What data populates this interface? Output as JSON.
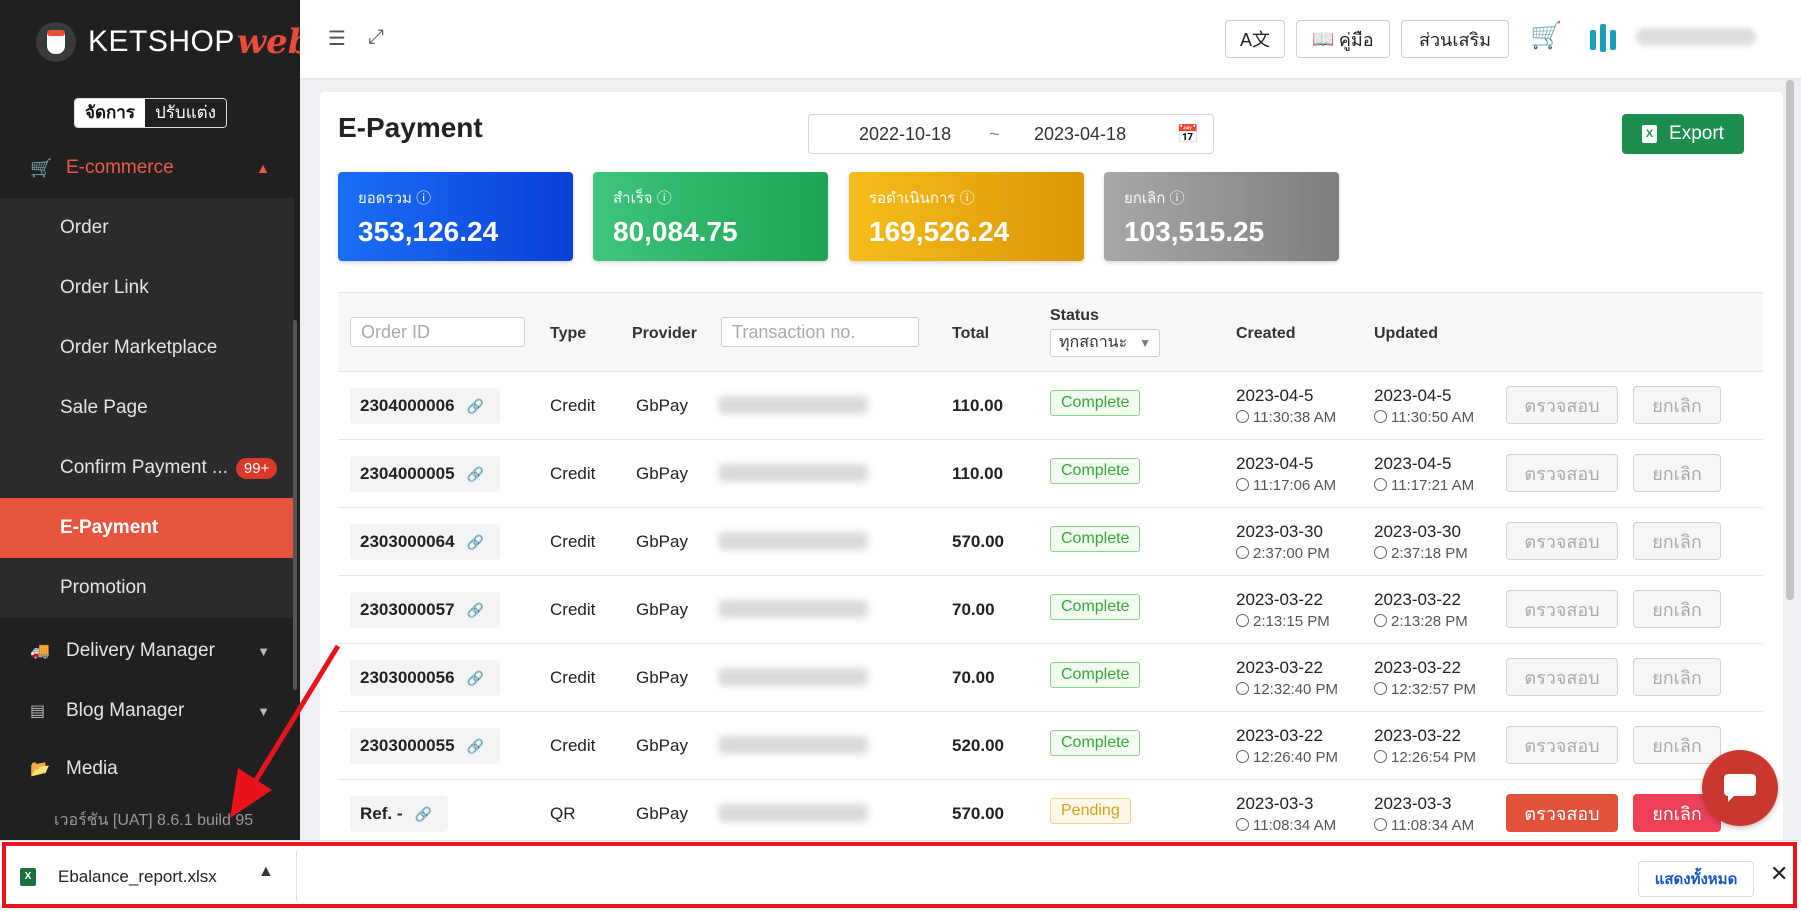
{
  "app": {
    "logo_text": "KETSHOP",
    "logo_accent": "web",
    "accent_color": "#e8553f"
  },
  "mode_switch": {
    "active": "จัดการ",
    "inactive": "ปรับแต่ง"
  },
  "sidebar": {
    "section": "E-commerce",
    "sub_items": [
      {
        "label": "Order"
      },
      {
        "label": "Order Link"
      },
      {
        "label": "Order Marketplace"
      },
      {
        "label": "Sale Page"
      },
      {
        "label": "Confirm Payment ...",
        "badge": "99+"
      },
      {
        "label": "E-Payment",
        "active": true
      },
      {
        "label": "Promotion"
      }
    ],
    "groups": [
      {
        "label": "Delivery Manager"
      },
      {
        "label": "Blog Manager"
      },
      {
        "label": "Media"
      }
    ],
    "version": "เวอร์ชัน [UAT] 8.6.1 build 95"
  },
  "topbar": {
    "btn_translate": "A文",
    "btn_manual": "คู่มือ",
    "btn_addon": "ส่วนเสริม"
  },
  "page": {
    "title": "E-Payment",
    "date_from": "2022-10-18",
    "date_sep": "~",
    "date_to": "2023-04-18",
    "export_label": "Export"
  },
  "stats": [
    {
      "label": "ยอดรวม",
      "value": "353,126.24"
    },
    {
      "label": "สำเร็จ",
      "value": "80,084.75"
    },
    {
      "label": "รอดำเนินการ",
      "value": "169,526.24"
    },
    {
      "label": "ยกเลิก",
      "value": "103,515.25"
    }
  ],
  "table": {
    "order_id_placeholder": "Order ID",
    "col_type": "Type",
    "col_provider": "Provider",
    "txn_placeholder": "Transaction no.",
    "col_total": "Total",
    "col_status": "Status",
    "status_filter": "ทุกสถานะ",
    "col_created": "Created",
    "col_updated": "Updated",
    "btn_check": "ตรวจสอบ",
    "btn_cancel": "ยกเลิก",
    "rows": [
      {
        "order_id": "2304000006",
        "type": "Credit",
        "provider": "GbPay",
        "total": "110.00",
        "status": "Complete",
        "created_date": "2023-04-5",
        "created_time": "11:30:38 AM",
        "updated_date": "2023-04-5",
        "updated_time": "11:30:50 AM"
      },
      {
        "order_id": "2304000005",
        "type": "Credit",
        "provider": "GbPay",
        "total": "110.00",
        "status": "Complete",
        "created_date": "2023-04-5",
        "created_time": "11:17:06 AM",
        "updated_date": "2023-04-5",
        "updated_time": "11:17:21 AM"
      },
      {
        "order_id": "2303000064",
        "type": "Credit",
        "provider": "GbPay",
        "total": "570.00",
        "status": "Complete",
        "created_date": "2023-03-30",
        "created_time": "2:37:00 PM",
        "updated_date": "2023-03-30",
        "updated_time": "2:37:18 PM"
      },
      {
        "order_id": "2303000057",
        "type": "Credit",
        "provider": "GbPay",
        "total": "70.00",
        "status": "Complete",
        "created_date": "2023-03-22",
        "created_time": "2:13:15 PM",
        "updated_date": "2023-03-22",
        "updated_time": "2:13:28 PM"
      },
      {
        "order_id": "2303000056",
        "type": "Credit",
        "provider": "GbPay",
        "total": "70.00",
        "status": "Complete",
        "created_date": "2023-03-22",
        "created_time": "12:32:40 PM",
        "updated_date": "2023-03-22",
        "updated_time": "12:32:57 PM"
      },
      {
        "order_id": "2303000055",
        "type": "Credit",
        "provider": "GbPay",
        "total": "520.00",
        "status": "Complete",
        "created_date": "2023-03-22",
        "created_time": "12:26:40 PM",
        "updated_date": "2023-03-22",
        "updated_time": "12:26:54 PM"
      },
      {
        "order_id": "Ref. -",
        "type": "QR",
        "provider": "GbPay",
        "total": "570.00",
        "status": "Pending",
        "created_date": "2023-03-3",
        "created_time": "11:08:34 AM",
        "updated_date": "2023-03-3",
        "updated_time": "11:08:34 AM"
      }
    ]
  },
  "download_bar": {
    "filename": "Ebalance_report.xlsx",
    "file_icon": "X",
    "show_all": "แสดงทั้งหมด",
    "close": "✕"
  }
}
